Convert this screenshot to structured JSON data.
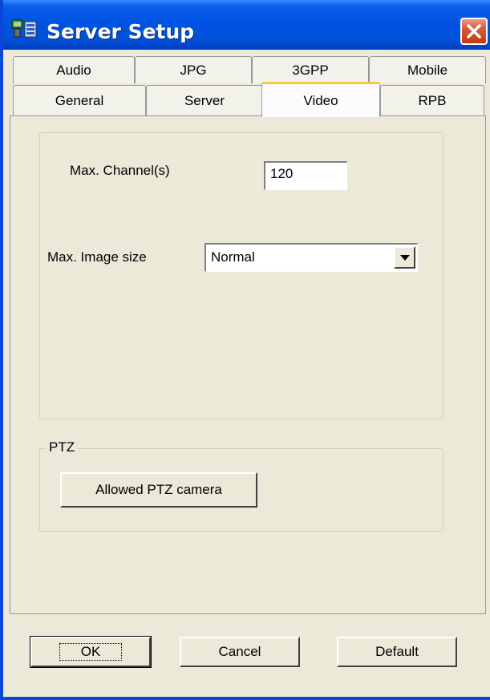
{
  "window": {
    "title": "Server Setup"
  },
  "tabs": {
    "row1": [
      "Audio",
      "JPG",
      "3GPP",
      "Mobile"
    ],
    "row2": [
      "General",
      "Server",
      "Video",
      "RPB"
    ],
    "active": "Video"
  },
  "video": {
    "max_channels_label": "Max. Channel(s)",
    "max_channels_value": "120",
    "max_image_size_label": "Max. Image size",
    "max_image_size_value": "Normal"
  },
  "ptz": {
    "group_label": "PTZ",
    "allowed_button": "Allowed PTZ camera"
  },
  "footer": {
    "ok": "OK",
    "cancel": "Cancel",
    "default": "Default"
  },
  "colors": {
    "titlebar": "#0054e3",
    "close_button": "#d85a36",
    "active_tab_accent": "#ffc83c",
    "window_bg": "#ece9d8"
  }
}
